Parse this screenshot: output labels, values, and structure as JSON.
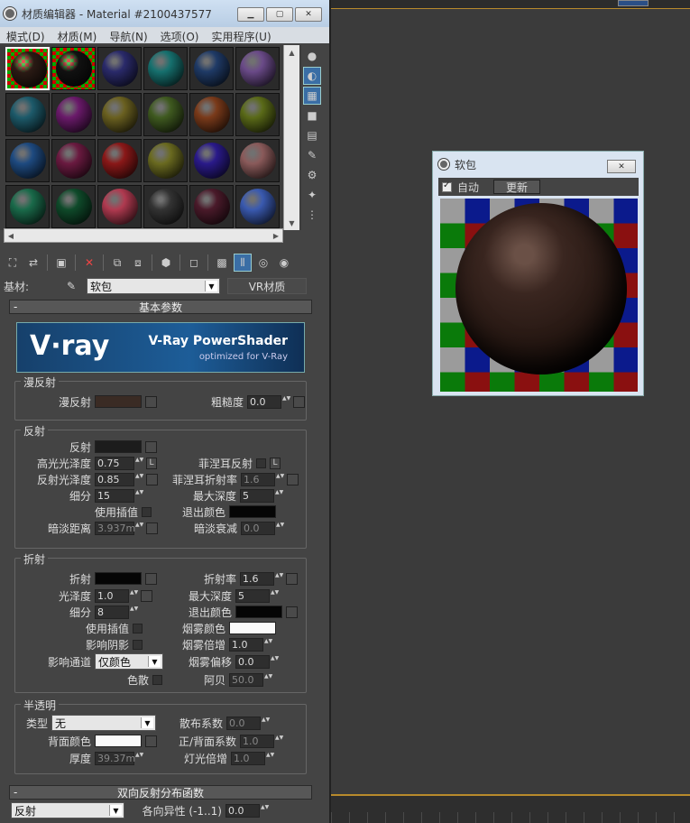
{
  "editor": {
    "title": "材质编辑器 - Material #2100437577",
    "menu": [
      "模式(D)",
      "材质(M)",
      "导航(N)",
      "选项(O)",
      "实用程序(U)"
    ],
    "slot_colors": [
      "#2a1a14",
      "#111111",
      "#2a2a6a",
      "#16706e",
      "#1f3a66",
      "#6a4a88",
      "#1d5a6a",
      "#6a1a6a",
      "#6a6020",
      "#3f5a20",
      "#7a3a1a",
      "#5a6a18",
      "#1e4a80",
      "#6a1a40",
      "#8a1818",
      "#6a6a20",
      "#2a1a8a",
      "#8a5a5a",
      "#1a6a4a",
      "#0f4a2a",
      "#b03a50",
      "#333333",
      "#4a1a2a",
      "#3a5ab0"
    ],
    "base_material_label": "基材:",
    "material_name": "软包",
    "material_type_button": "VR材质"
  },
  "basic": {
    "header": "基本参数",
    "banner_logo": "V·ray",
    "banner_line1": "V-Ray PowerShader",
    "banner_line2": "optimized for V-Ray",
    "diffuse_group": "漫反射",
    "diffuse_label": "漫反射",
    "diffuse_color": "#3a2b24",
    "roughness_label": "粗糙度",
    "roughness_value": "0.0",
    "reflect_group": "反射",
    "reflect_label": "反射",
    "reflect_color": "#1c1c1c",
    "hilight_gloss_label": "高光光泽度",
    "hilight_gloss_value": "0.75",
    "L1": "L",
    "fresnel_label": "菲涅耳反射",
    "L2": "L",
    "refl_gloss_label": "反射光泽度",
    "refl_gloss_value": "0.85",
    "fresnel_ior_label": "菲涅耳折射率",
    "fresnel_ior_value": "1.6",
    "subdivs_label": "细分",
    "subdivs_value": "15",
    "max_depth_label": "最大深度",
    "max_depth_value": "5",
    "use_interp_label": "使用插值",
    "exit_color_label": "退出颜色",
    "dim_dist_label": "暗淡距离",
    "dim_dist_value": "3.937m",
    "dim_falloff_label": "暗淡衰减",
    "dim_falloff_value": "0.0",
    "refract_group": "折射",
    "refract_label": "折射",
    "ior_label": "折射率",
    "ior_value": "1.6",
    "gloss_label": "光泽度",
    "gloss_value": "1.0",
    "r_max_depth_label": "最大深度",
    "r_max_depth_value": "5",
    "r_subdivs_label": "细分",
    "r_subdivs_value": "8",
    "r_exit_label": "退出颜色",
    "r_use_interp_label": "使用插值",
    "fog_color_label": "烟雾颜色",
    "affect_shadows_label": "影响阴影",
    "fog_mult_label": "烟雾倍增",
    "fog_mult_value": "1.0",
    "affect_channels_label": "影响通道",
    "affect_channels_value": "仅颜色",
    "fog_bias_label": "烟雾偏移",
    "fog_bias_value": "0.0",
    "dispersion_label": "色散",
    "abbe_label": "阿贝",
    "abbe_value": "50.0",
    "translucency_group": "半透明",
    "type_label": "类型",
    "type_value": "无",
    "scatter_label": "散布系数",
    "scatter_value": "0.0",
    "back_color_label": "背面颜色",
    "fwd_back_label": "正/背面系数",
    "fwd_back_value": "1.0",
    "thickness_label": "厚度",
    "thickness_value": "39.37m",
    "light_mult_label": "灯光倍增",
    "light_mult_value": "1.0"
  },
  "brdf": {
    "header": "双向反射分布函数",
    "type_value": "反射",
    "aniso_label": "各向异性 (-1..1)",
    "aniso_value": "0.0"
  },
  "preview": {
    "title": "软包",
    "auto_label": "自动",
    "update_button": "更新"
  }
}
